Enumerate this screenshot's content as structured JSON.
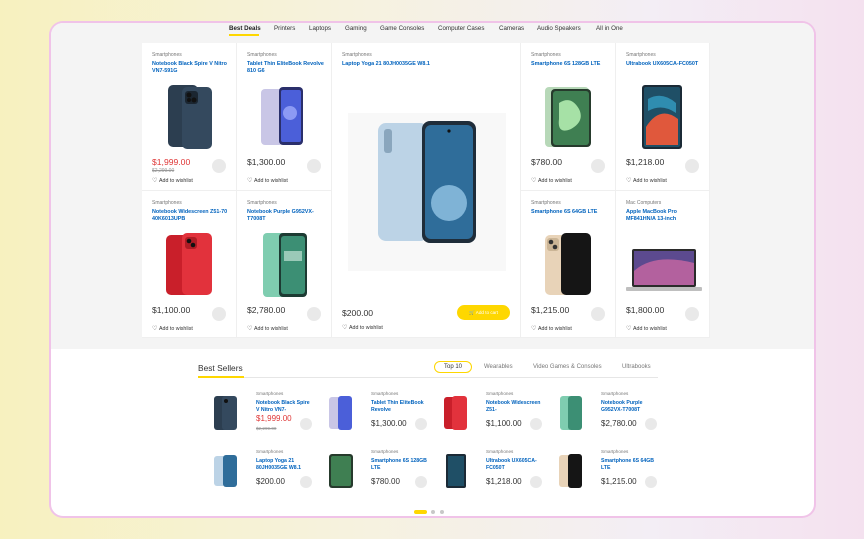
{
  "tabs": [
    {
      "label": "Best Deals",
      "active": true
    },
    {
      "label": "Printers"
    },
    {
      "label": "Laptops"
    },
    {
      "label": "Gaming"
    },
    {
      "label": "Game Consoles"
    },
    {
      "label": "Computer Cases"
    },
    {
      "label": "Cameras"
    },
    {
      "label": "Audio Speakers"
    },
    {
      "label": "All in One"
    }
  ],
  "products": [
    {
      "category": "Smartphones",
      "title": "Notebook Black Spire V Nitro VN7-591G",
      "price": "$1,999.00",
      "old_price": "$2,299.00",
      "wishlist": "Add to wishlist",
      "image": "phone-blue"
    },
    {
      "category": "Smartphones",
      "title": "Tablet Thin EliteBook Revolve 810 G6",
      "price": "$1,300.00",
      "wishlist": "Add to wishlist",
      "image": "phone-violet"
    },
    {
      "category": "Smartphones",
      "title": "Laptop Yoga 21 80JH0035GE W8.1",
      "price": "$200.00",
      "wishlist": "Add to wishlist",
      "add_to_cart": "Add to cart",
      "image": "galaxy"
    },
    {
      "category": "Smartphones",
      "title": "Smartphone 6S 128GB LTE",
      "price": "$780.00",
      "wishlist": "Add to wishlist",
      "image": "ipad-green"
    },
    {
      "category": "Smartphones",
      "title": "Ultrabook UX605CA-FC050T",
      "price": "$1,218.00",
      "wishlist": "Add to wishlist",
      "image": "tablet-dark"
    },
    {
      "category": "Smartphones",
      "title": "Notebook Widescreen Z51-70 40K6013UPB",
      "price": "$1,100.00",
      "wishlist": "Add to wishlist",
      "image": "phone-red"
    },
    {
      "category": "Smartphones",
      "title": "Notebook Purple G952VX-T7008T",
      "price": "$2,780.00",
      "wishlist": "Add to wishlist",
      "image": "phone-green"
    },
    {
      "category": "Smartphones",
      "title": "Smartphone 6S 64GB LTE",
      "price": "$1,215.00",
      "wishlist": "Add to wishlist",
      "image": "phone-gold"
    },
    {
      "category": "Mac Computers",
      "title": "Apple MacBook Pro MF841HN/A 13-inch",
      "price": "$1,800.00",
      "wishlist": "Add to wishlist",
      "image": "macbook"
    }
  ],
  "bestsellers": {
    "title": "Best Sellers",
    "tabs": [
      {
        "label": "Top 10",
        "active": true
      },
      {
        "label": "Wearables"
      },
      {
        "label": "Video Games & Consoles"
      },
      {
        "label": "Ultrabooks"
      }
    ],
    "items": [
      {
        "category": "Smartphones",
        "title": "Notebook Black Spire V Nitro VN7-",
        "price": "$1,999.00",
        "old_price": "$2,299.00",
        "image": "phone-blue"
      },
      {
        "category": "Smartphones",
        "title": "Tablet Thin EliteBook Revolve",
        "price": "$1,300.00",
        "image": "phone-violet"
      },
      {
        "category": "Smartphones",
        "title": "Notebook Widescreen Z51-",
        "price": "$1,100.00",
        "image": "phone-red"
      },
      {
        "category": "Smartphones",
        "title": "Notebook Purple G952VX-T7008T",
        "price": "$2,780.00",
        "image": "phone-green"
      },
      {
        "category": "Smartphones",
        "title": "Laptop Yoga 21 80JH0035GE W8.1",
        "price": "$200.00",
        "image": "galaxy"
      },
      {
        "category": "Smartphones",
        "title": "Smartphone 6S 128GB LTE",
        "price": "$780.00",
        "image": "ipad-green"
      },
      {
        "category": "Smartphones",
        "title": "Ultrabook UX605CA-FC050T",
        "price": "$1,218.00",
        "image": "tablet-dark"
      },
      {
        "category": "Smartphones",
        "title": "Smartphone 6S 64GB LTE",
        "price": "$1,215.00",
        "image": "phone-gold"
      }
    ]
  },
  "colors": {
    "accent": "#fed700",
    "link": "#0062bd",
    "sale": "#df3737"
  }
}
